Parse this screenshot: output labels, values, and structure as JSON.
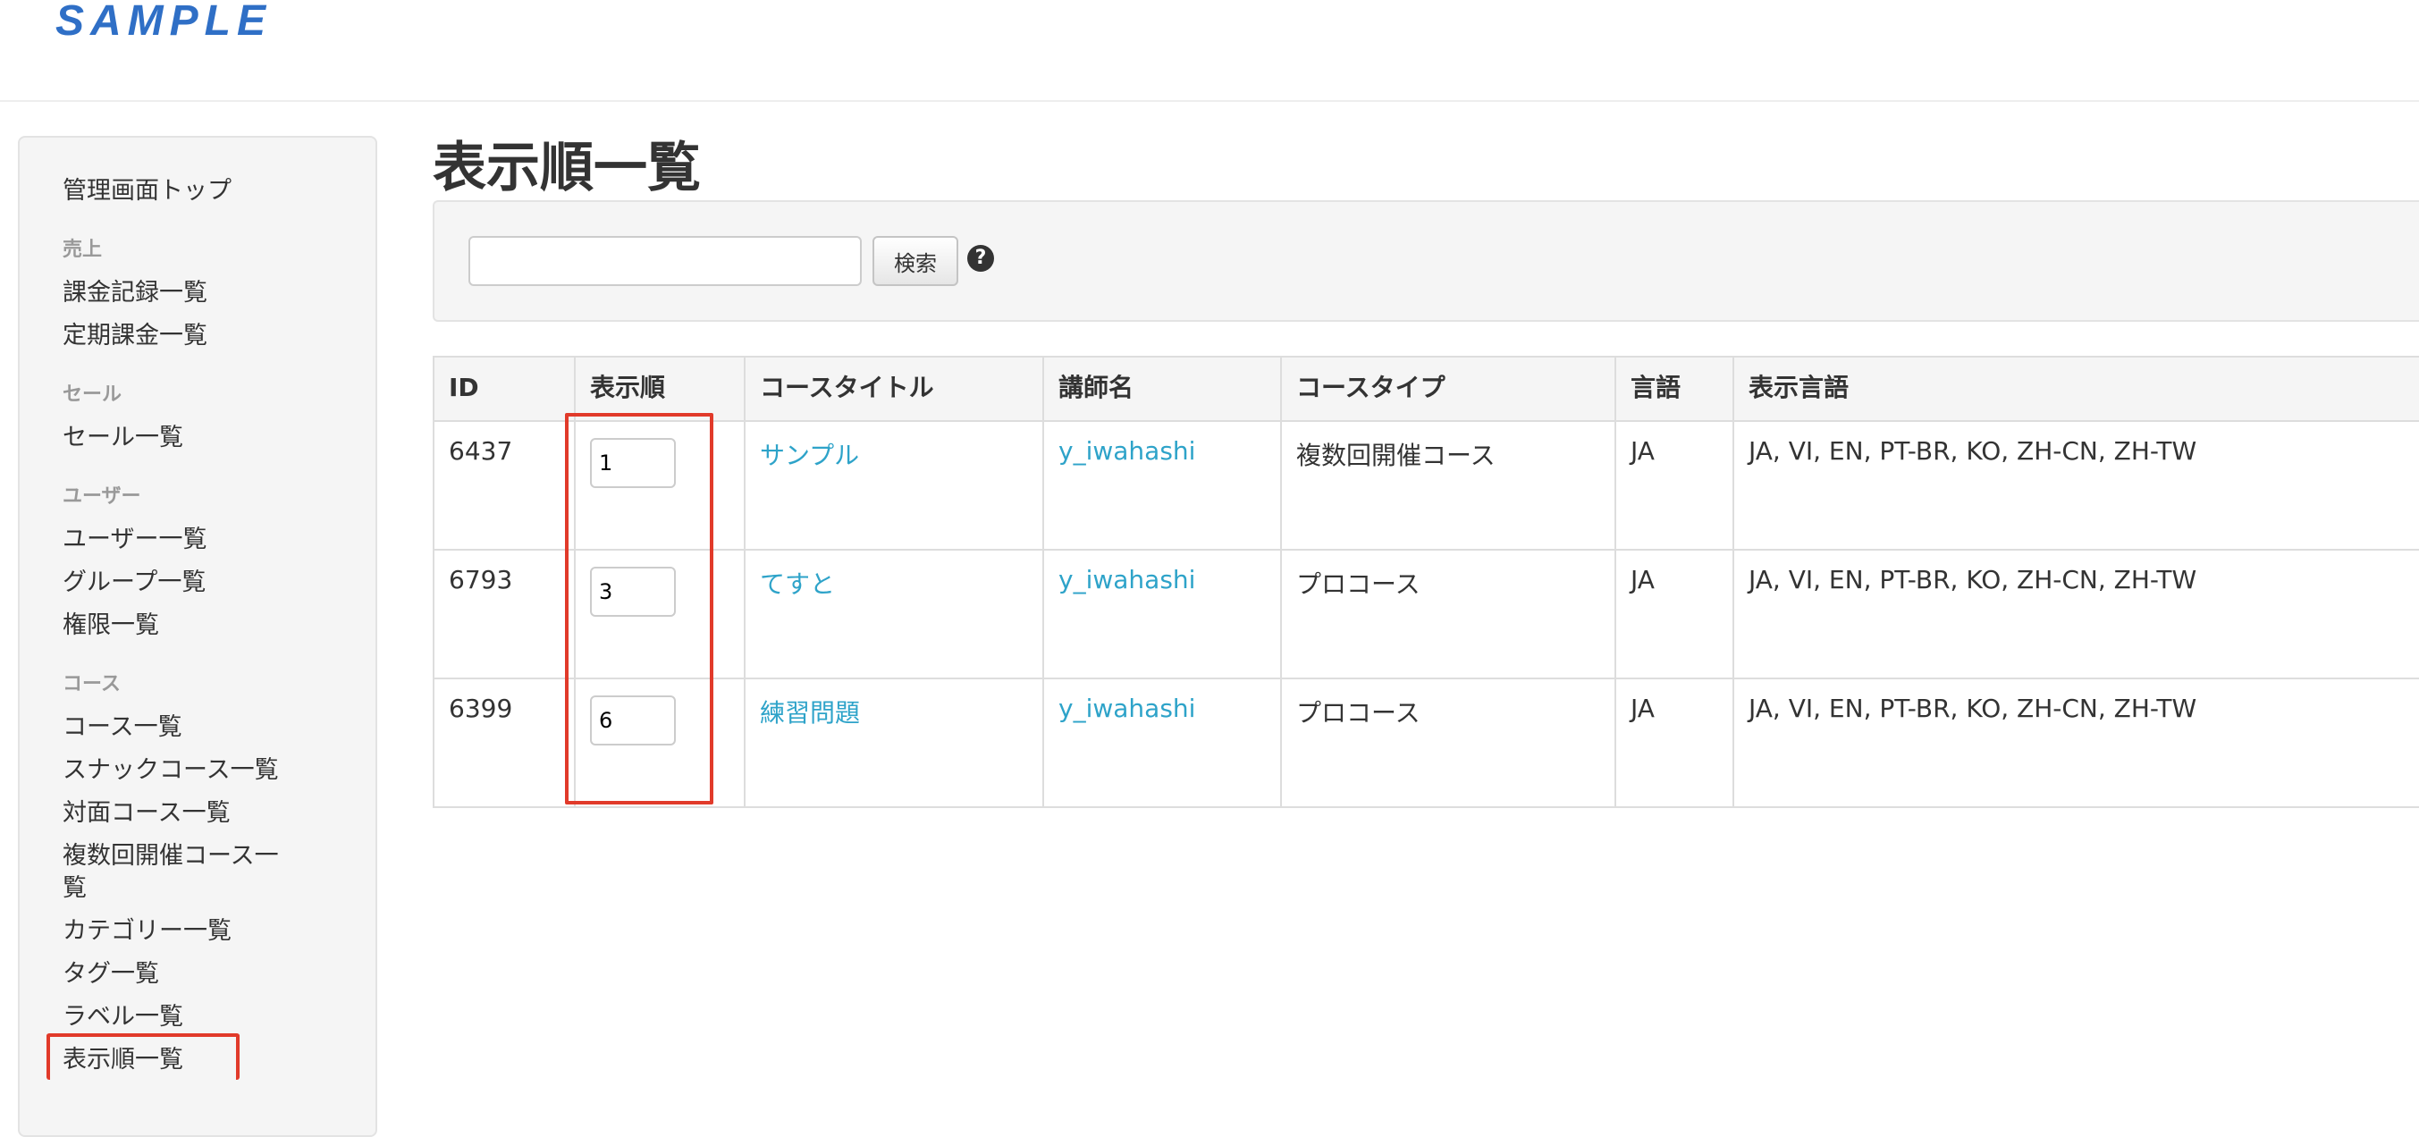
{
  "header": {
    "logo_text": "SAMPLE"
  },
  "sidebar": {
    "top_link": "管理画面トップ",
    "sections": {
      "sales": {
        "header": "売上",
        "items": [
          "課金記録一覧",
          "定期課金一覧"
        ]
      },
      "sale": {
        "header": "セール",
        "items": [
          "セール一覧"
        ]
      },
      "users": {
        "header": "ユーザー",
        "items": [
          "ユーザー一覧",
          "グループ一覧",
          "権限一覧"
        ]
      },
      "courses": {
        "header": "コース",
        "items": [
          "コース一覧",
          "スナックコース一覧",
          "対面コース一覧",
          "複数回開催コース一覧",
          "カテゴリー一覧",
          "タグ一覧",
          "ラベル一覧",
          "表示順一覧"
        ]
      }
    },
    "active_item": "表示順一覧"
  },
  "main": {
    "title": "表示順一覧",
    "search": {
      "input_value": "",
      "button_label": "検索",
      "help_icon": "question-circle-icon"
    },
    "table": {
      "headers": [
        "ID",
        "表示順",
        "コースタイトル",
        "講師名",
        "コースタイプ",
        "言語",
        "表示言語"
      ],
      "rows": [
        {
          "id": "6437",
          "order": "1",
          "title": "サンプル",
          "instructor": "y_iwahashi",
          "type": "複数回開催コース",
          "language": "JA",
          "display_languages": "JA, VI, EN, PT-BR, KO, ZH-CN, ZH-TW"
        },
        {
          "id": "6793",
          "order": "3",
          "title": "てすと",
          "instructor": "y_iwahashi",
          "type": "プロコース",
          "language": "JA",
          "display_languages": "JA, VI, EN, PT-BR, KO, ZH-CN, ZH-TW"
        },
        {
          "id": "6399",
          "order": "6",
          "title": "練習問題",
          "instructor": "y_iwahashi",
          "type": "プロコース",
          "language": "JA",
          "display_languages": "JA, VI, EN, PT-BR, KO, ZH-CN, ZH-TW"
        }
      ]
    }
  },
  "colors": {
    "link": "#2ea3c9",
    "highlight_border": "#e13a2a",
    "logo": "#2f6fc6"
  }
}
